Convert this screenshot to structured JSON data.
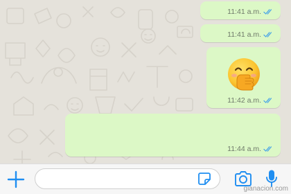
{
  "messages": [
    {
      "time": "11:41 a.m.",
      "status": "read"
    },
    {
      "time": "11:41 a.m.",
      "status": "read"
    },
    {
      "time": "11:42 a.m.",
      "status": "read",
      "content": "emoji",
      "emoji": "face-with-hand-over-mouth"
    },
    {
      "time": "11:44 a.m.",
      "status": "read",
      "content": "blank"
    }
  ],
  "composer": {
    "value": "",
    "placeholder": ""
  },
  "icons": {
    "attach": "plus-icon",
    "sticker": "sticker-icon",
    "camera": "camera-icon",
    "voice": "microphone-icon"
  },
  "colors": {
    "accent": "#1f8ef1",
    "bubble": "#dcf8c6",
    "read_ticks": "#4fa8e6",
    "wallpaper": "#e5e2db"
  },
  "watermark": "gianacion.com"
}
